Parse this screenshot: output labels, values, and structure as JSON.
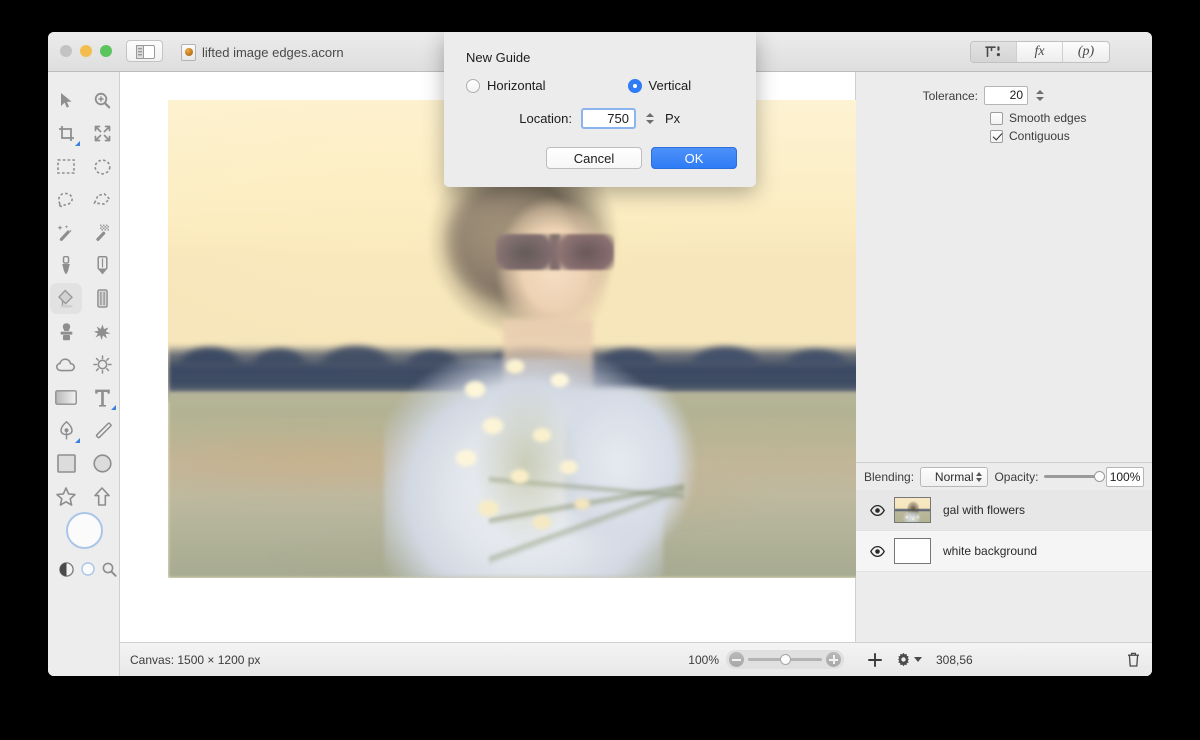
{
  "window": {
    "traffic_lights": [
      "close",
      "minimize",
      "maximize"
    ],
    "sidebar_toggle_icon": "sidebar-toggle-icon",
    "document_title": "lifted image edges.acorn",
    "document_icon": "acorn-document-icon",
    "toolbar_segments": [
      {
        "name": "tool-options",
        "label": "",
        "icon": "tool-options-icon",
        "active": true
      },
      {
        "name": "filters",
        "label": "fx",
        "icon": "fx-icon",
        "active": false
      },
      {
        "name": "palettes",
        "label": "(p)",
        "icon": "palettes-icon",
        "active": false
      }
    ]
  },
  "palette": {
    "tools": [
      {
        "name": "move-tool",
        "icon": "arrow-cursor-icon",
        "selected": false,
        "submenu": false
      },
      {
        "name": "zoom-tool",
        "icon": "magnifier-plus-icon",
        "selected": false,
        "submenu": false
      },
      {
        "name": "crop-tool",
        "icon": "crop-icon",
        "selected": false,
        "submenu": true
      },
      {
        "name": "transform-tool",
        "icon": "move-arrows-icon",
        "selected": false,
        "submenu": false
      },
      {
        "name": "rect-select-tool",
        "icon": "rect-marquee-icon",
        "selected": false,
        "submenu": false
      },
      {
        "name": "ellipse-select-tool",
        "icon": "ellipse-marquee-icon",
        "selected": false,
        "submenu": false
      },
      {
        "name": "lasso-tool",
        "icon": "lasso-icon",
        "selected": false,
        "submenu": false
      },
      {
        "name": "polygon-lasso-tool",
        "icon": "polygon-lasso-icon",
        "selected": false,
        "submenu": false
      },
      {
        "name": "magic-wand-tool",
        "icon": "magic-wand-icon",
        "selected": false,
        "submenu": false
      },
      {
        "name": "instant-alpha-tool",
        "icon": "instant-alpha-icon",
        "selected": false,
        "submenu": false
      },
      {
        "name": "brush-tool",
        "icon": "brush-icon",
        "selected": false,
        "submenu": false
      },
      {
        "name": "pencil-tool",
        "icon": "pencil-icon",
        "selected": false,
        "submenu": false
      },
      {
        "name": "paint-bucket-tool",
        "icon": "paint-bucket-icon",
        "selected": true,
        "submenu": false
      },
      {
        "name": "eraser-tool",
        "icon": "eraser-icon",
        "selected": false,
        "submenu": false
      },
      {
        "name": "clone-stamp-tool",
        "icon": "clone-stamp-icon",
        "selected": false,
        "submenu": false
      },
      {
        "name": "smudge-tool",
        "icon": "smudge-icon",
        "selected": false,
        "submenu": false
      },
      {
        "name": "blur-tool",
        "icon": "cloud-blur-icon",
        "selected": false,
        "submenu": false
      },
      {
        "name": "dodge-tool",
        "icon": "sun-dodge-icon",
        "selected": false,
        "submenu": false
      },
      {
        "name": "gradient-tool",
        "icon": "gradient-icon",
        "selected": false,
        "submenu": false
      },
      {
        "name": "text-tool",
        "icon": "text-t-icon",
        "selected": false,
        "submenu": true
      },
      {
        "name": "bezier-pen-tool",
        "icon": "pen-nib-icon",
        "selected": false,
        "submenu": true
      },
      {
        "name": "line-tool",
        "icon": "line-icon",
        "selected": false,
        "submenu": false
      },
      {
        "name": "rectangle-shape-tool",
        "icon": "rectangle-icon",
        "selected": false,
        "submenu": false
      },
      {
        "name": "ellipse-shape-tool",
        "icon": "circle-icon",
        "selected": false,
        "submenu": false
      },
      {
        "name": "star-shape-tool",
        "icon": "star-icon",
        "selected": false,
        "submenu": false
      },
      {
        "name": "arrow-shape-tool",
        "icon": "arrow-up-icon",
        "selected": false,
        "submenu": false
      }
    ],
    "color_well": {
      "name": "foreground-color-well",
      "color": "#FBFBFB",
      "ring": "#A9C6E8"
    },
    "bottom_controls": [
      {
        "name": "swap-colors-button",
        "icon": "half-circle-icon"
      },
      {
        "name": "default-colors-button",
        "icon": "small-circle-icon"
      },
      {
        "name": "color-picker-button",
        "icon": "magnifier-icon"
      }
    ]
  },
  "canvas": {
    "status_text": "Canvas: 1500 × 1200 px",
    "zoom_level": "100%",
    "zoom_out_icon": "zoom-out-icon",
    "zoom_in_icon": "zoom-in-icon"
  },
  "inspector": {
    "tool_options": {
      "tolerance_label": "Tolerance:",
      "tolerance_value": "20",
      "checkboxes": [
        {
          "name": "smooth-edges-checkbox",
          "label": "Smooth edges",
          "checked": false
        },
        {
          "name": "contiguous-checkbox",
          "label": "Contiguous",
          "checked": true
        }
      ]
    },
    "layers": {
      "blending_label": "Blending:",
      "blending_value": "Normal",
      "opacity_label": "Opacity:",
      "opacity_value": "100%",
      "opacity_percent": 100,
      "rows": [
        {
          "name": "layer-gal-with-flowers",
          "label": "gal with flowers",
          "visible": true,
          "selected": true,
          "thumb": "photo"
        },
        {
          "name": "layer-white-background",
          "label": "white background",
          "visible": true,
          "selected": false,
          "thumb": "white"
        }
      ],
      "footer": {
        "add_icon": "plus-icon",
        "gear_icon": "gear-icon",
        "coordinates": "308,56",
        "trash_icon": "trash-icon"
      }
    }
  },
  "dialog": {
    "title": "New Guide",
    "orientation_options": [
      {
        "name": "radio-horizontal",
        "label": "Horizontal",
        "selected": false
      },
      {
        "name": "radio-vertical",
        "label": "Vertical",
        "selected": true
      }
    ],
    "location_label": "Location:",
    "location_value": "750",
    "unit_label": "Px",
    "cancel_label": "Cancel",
    "ok_label": "OK",
    "accent_color": "#2F7CF6"
  }
}
